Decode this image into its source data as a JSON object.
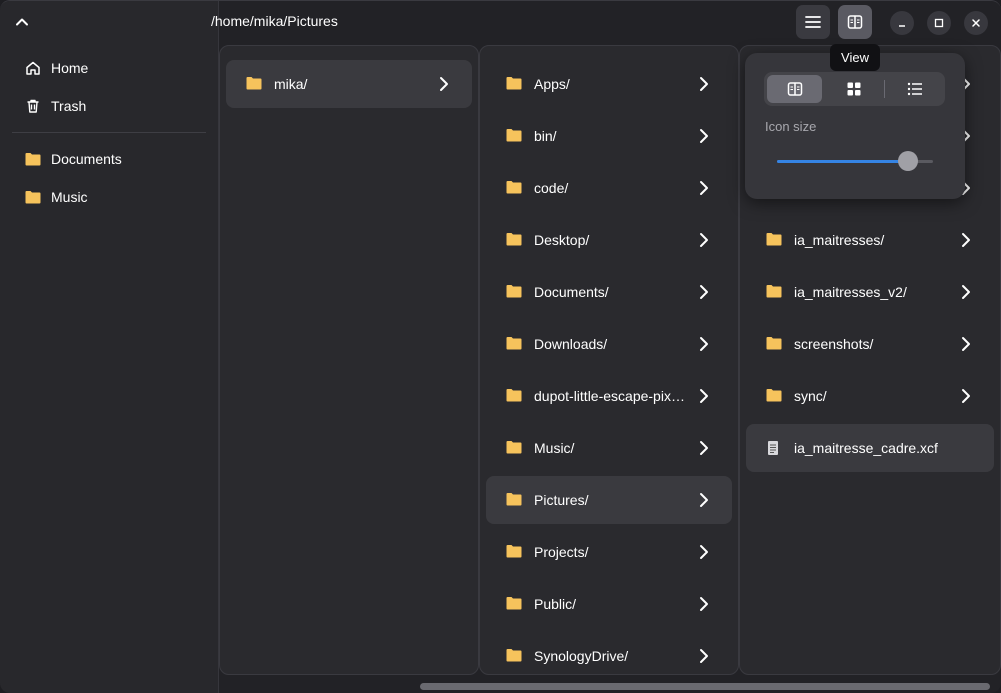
{
  "header": {
    "path": "/home/mika/Pictures"
  },
  "tooltip": {
    "text": "View"
  },
  "sidebar": {
    "items": [
      {
        "label": "Home",
        "icon": "home-icon"
      },
      {
        "label": "Trash",
        "icon": "trash-icon"
      }
    ],
    "bookmarks": [
      {
        "label": "Documents",
        "icon": "folder-icon"
      },
      {
        "label": "Music",
        "icon": "folder-icon"
      }
    ]
  },
  "columns": [
    {
      "items": [
        {
          "name": "mika/",
          "type": "folder",
          "selected": true
        }
      ]
    },
    {
      "items": [
        {
          "name": "Apps/",
          "type": "folder"
        },
        {
          "name": "bin/",
          "type": "folder"
        },
        {
          "name": "code/",
          "type": "folder"
        },
        {
          "name": "Desktop/",
          "type": "folder"
        },
        {
          "name": "Documents/",
          "type": "folder"
        },
        {
          "name": "Downloads/",
          "type": "folder"
        },
        {
          "name": "dupot-little-escape-pix…",
          "type": "folder"
        },
        {
          "name": "Music/",
          "type": "folder"
        },
        {
          "name": "Pictures/",
          "type": "folder",
          "selected": true
        },
        {
          "name": "Projects/",
          "type": "folder"
        },
        {
          "name": "Public/",
          "type": "folder"
        },
        {
          "name": "SynologyDrive/",
          "type": "folder"
        }
      ]
    },
    {
      "items": [
        {
          "name": "",
          "type": "folder",
          "hidden": true
        },
        {
          "name": "",
          "type": "folder",
          "hidden": true
        },
        {
          "name": "",
          "type": "folder",
          "hidden": true
        },
        {
          "name": "ia_maitresses/",
          "type": "folder"
        },
        {
          "name": "ia_maitresses_v2/",
          "type": "folder"
        },
        {
          "name": "screenshots/",
          "type": "folder"
        },
        {
          "name": "sync/",
          "type": "folder"
        },
        {
          "name": "ia_maitresse_cadre.xcf",
          "type": "file",
          "selected": true
        }
      ]
    }
  ],
  "view_popover": {
    "modes": [
      "columns-view-icon",
      "grid-view-icon",
      "list-view-icon"
    ],
    "active_mode": 0,
    "icon_size_label": "Icon size",
    "icon_size_value": 0.84
  },
  "colors": {
    "folder": "#f6c35c",
    "accent": "#3584e4"
  }
}
